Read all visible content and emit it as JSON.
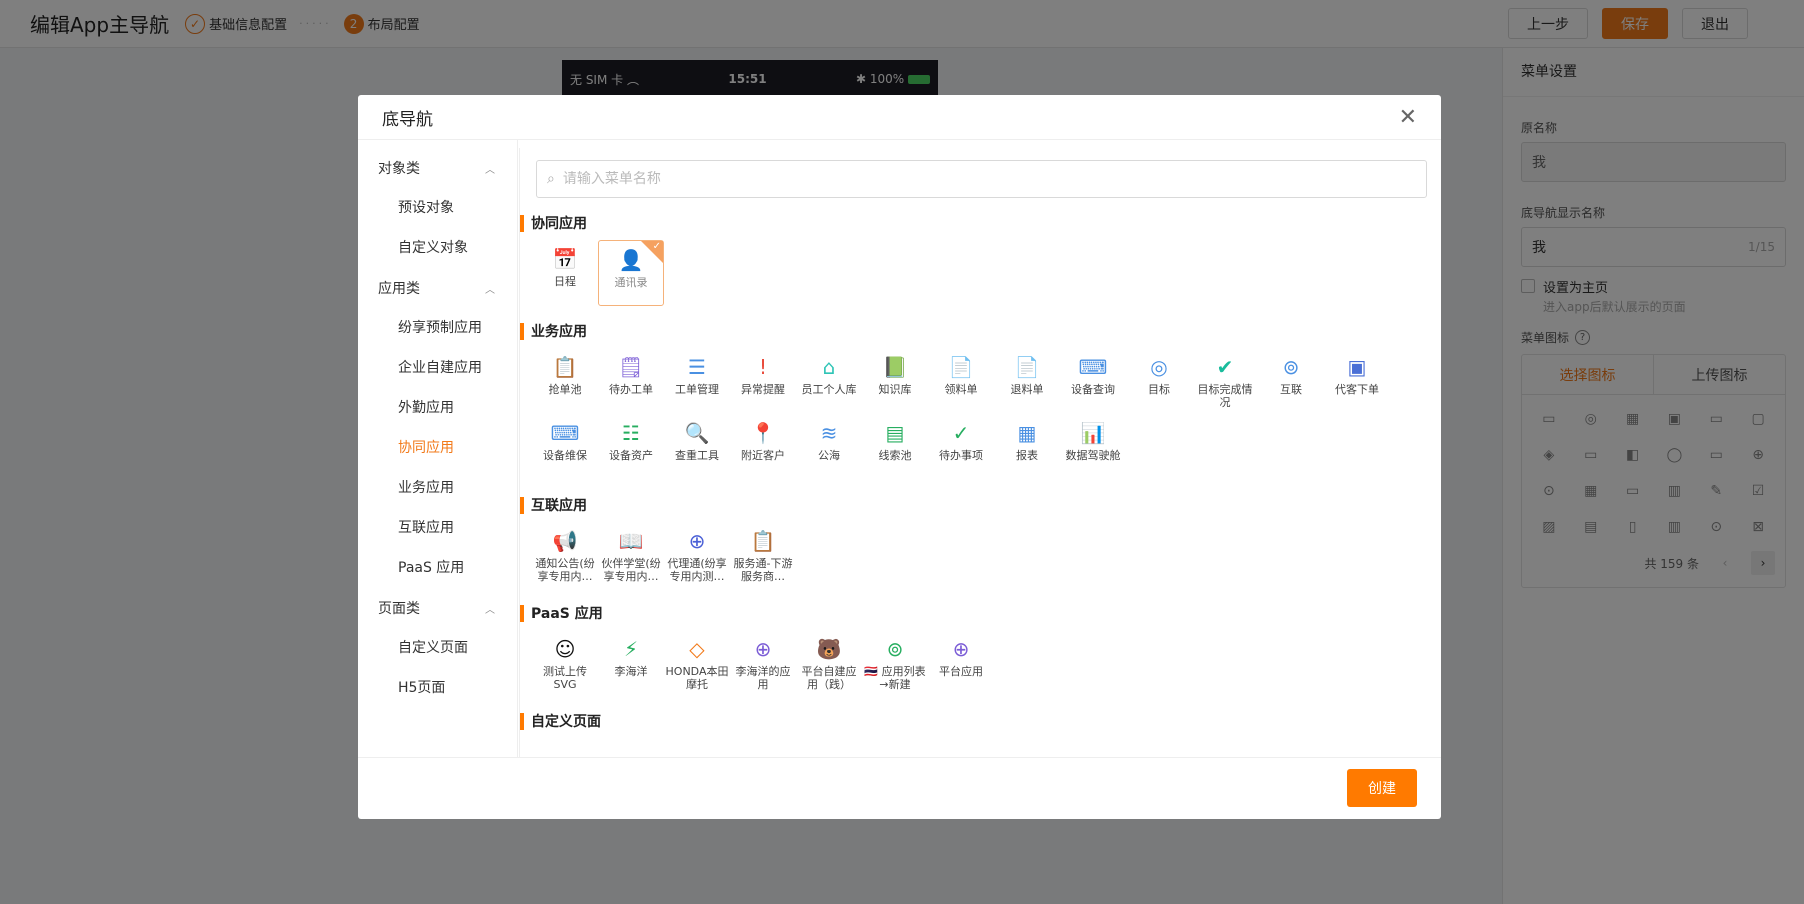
{
  "header": {
    "title": "编辑App主导航",
    "step1": "基础信息配置",
    "step2_num": "2",
    "step2": "布局配置",
    "prev_label": "上一步",
    "save_label": "保存",
    "exit_label": "退出"
  },
  "phone": {
    "carrier": "无 SIM 卡",
    "time": "15:51",
    "battery": "100%"
  },
  "right_panel": {
    "title": "菜单设置",
    "original_name_label": "原名称",
    "original_name_value": "我",
    "display_name_label": "底导航显示名称",
    "display_name_value": "我",
    "display_name_count": "1/15",
    "home_checkbox_label": "设置为主页",
    "home_checkbox_hint": "进入app后默认展示的页面",
    "menu_icon_label": "菜单图标",
    "tab_select": "选择图标",
    "tab_upload": "上传图标",
    "icons": [
      "▭",
      "◎",
      "▦",
      "▣",
      "▭",
      "▢",
      "◈",
      "▭",
      "◧",
      "◯",
      "▭",
      "⊕",
      "⊙",
      "▦",
      "▭",
      "▥",
      "✎",
      "☑",
      "▨",
      "▤",
      "▯",
      "▥",
      "⊙",
      "⊠"
    ],
    "total": "共 159 条",
    "prev": "‹",
    "next": "›"
  },
  "modal": {
    "title": "底导航",
    "close": "✕",
    "create_label": "创建",
    "search_placeholder": "请输入菜单名称",
    "nav": [
      {
        "group": "对象类",
        "items": [
          "预设对象",
          "自定义对象"
        ]
      },
      {
        "group": "应用类",
        "items": [
          "纷享预制应用",
          "企业自建应用",
          "外勤应用",
          "协同应用",
          "业务应用",
          "互联应用",
          "PaaS 应用"
        ]
      },
      {
        "group": "页面类",
        "items": [
          "自定义页面",
          "H5页面"
        ]
      }
    ],
    "active_nav": "协同应用",
    "sections": [
      {
        "title": "协同应用",
        "tiles": [
          {
            "label": "日程",
            "icon": "📅",
            "color": "#7b5cd6"
          },
          {
            "label": "通讯录",
            "icon": "👤",
            "color": "#f5a160",
            "selected": true
          }
        ]
      },
      {
        "title": "业务应用",
        "tiles": [
          {
            "label": "抢单池",
            "icon": "📋",
            "color": "#f5a623"
          },
          {
            "label": "待办工单",
            "icon": "🗒",
            "color": "#7b5cd6"
          },
          {
            "label": "工单管理",
            "icon": "☰",
            "color": "#4a90e2"
          },
          {
            "label": "异常提醒",
            "icon": "!",
            "color": "#e94b3c"
          },
          {
            "label": "员工个人库",
            "icon": "⌂",
            "color": "#2ec4b6"
          },
          {
            "label": "知识库",
            "icon": "📗",
            "color": "#27ae60"
          },
          {
            "label": "领料单",
            "icon": "📄",
            "color": "#7b5cd6"
          },
          {
            "label": "退料单",
            "icon": "📄",
            "color": "#e94b3c"
          },
          {
            "label": "设备查询",
            "icon": "⌨",
            "color": "#4a90e2"
          },
          {
            "label": "目标",
            "icon": "◎",
            "color": "#4a90e2"
          },
          {
            "label": "目标完成情况",
            "icon": "✔",
            "color": "#1abc9c"
          },
          {
            "label": "互联",
            "icon": "⊚",
            "color": "#4a90e2"
          },
          {
            "label": "代客下单",
            "icon": "▣",
            "color": "#4a6fd6"
          },
          {
            "label": "设备维保",
            "icon": "⌨",
            "color": "#4a90e2"
          },
          {
            "label": "设备资产",
            "icon": "☷",
            "color": "#27ae60"
          },
          {
            "label": "查重工具",
            "icon": "🔍",
            "color": "#7b5cd6"
          },
          {
            "label": "附近客户",
            "icon": "📍",
            "color": "#7b5cd6"
          },
          {
            "label": "公海",
            "icon": "≋",
            "color": "#4a90e2"
          },
          {
            "label": "线索池",
            "icon": "▤",
            "color": "#27ae60"
          },
          {
            "label": "待办事项",
            "icon": "✓",
            "color": "#27ae60"
          },
          {
            "label": "报表",
            "icon": "▦",
            "color": "#4a90e2"
          },
          {
            "label": "数据驾驶舱",
            "icon": "📊",
            "color": "#e94b3c"
          }
        ]
      },
      {
        "title": "互联应用",
        "tiles": [
          {
            "label": "通知公告(纷享专用内…",
            "icon": "📢",
            "color": "#f27a1a"
          },
          {
            "label": "伙伴学堂(纷享专用内…",
            "icon": "📖",
            "color": "#8bc34a"
          },
          {
            "label": "代理通(纷享专用内测…",
            "icon": "⊕",
            "color": "#4a5fd6"
          },
          {
            "label": "服务通-下游服务商…",
            "icon": "📋",
            "color": "#f27a1a"
          }
        ]
      },
      {
        "title": "PaaS 应用",
        "tiles": [
          {
            "label": "测试上传SVG",
            "icon": "☺",
            "color": "#111"
          },
          {
            "label": "李海洋",
            "icon": "⚡",
            "color": "#27ae60"
          },
          {
            "label": "HONDA本田摩托",
            "icon": "◇",
            "color": "#f27a1a"
          },
          {
            "label": "李海洋的应用",
            "icon": "⊕",
            "color": "#7b5cd6"
          },
          {
            "label": "平台自建应用（践）",
            "icon": "🐻",
            "color": "#8b5a2b"
          },
          {
            "label": "🇹🇭 应用列表→新建",
            "icon": "⊚",
            "color": "#27ae60"
          },
          {
            "label": "平台应用",
            "icon": "⊕",
            "color": "#7b5cd6"
          }
        ]
      },
      {
        "title": "自定义页面",
        "tiles": []
      }
    ]
  }
}
